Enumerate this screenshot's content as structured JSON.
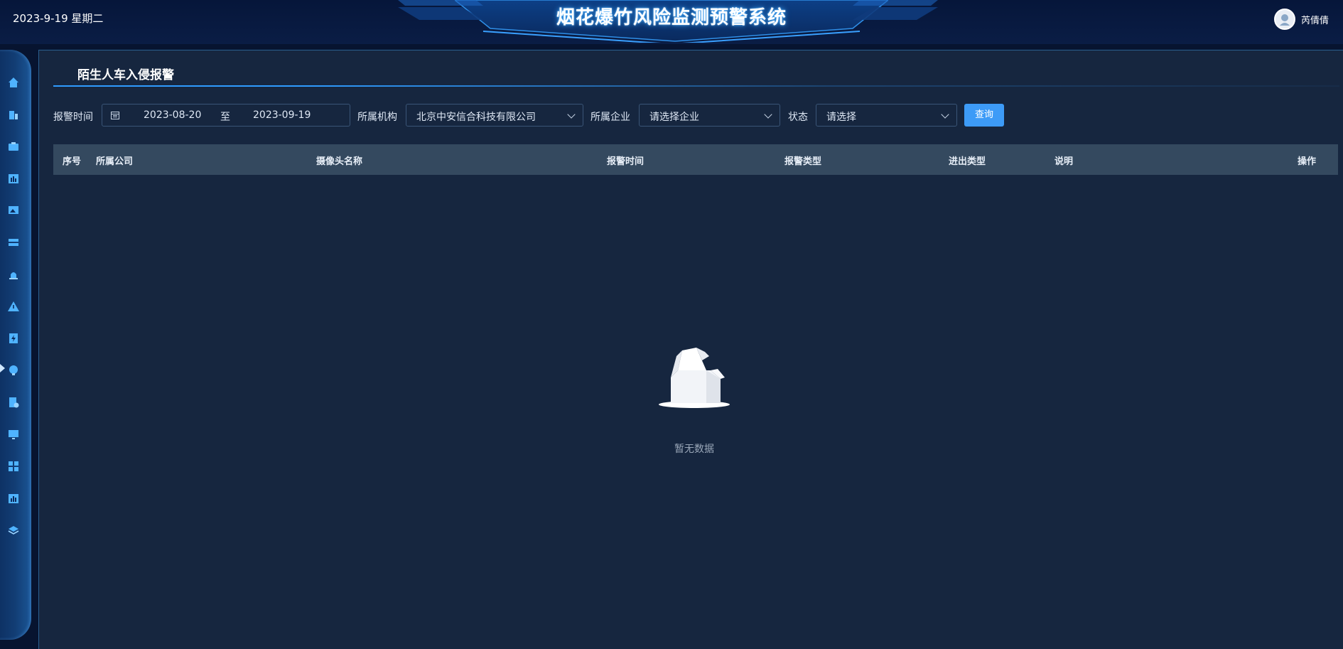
{
  "header": {
    "date": "2023-9-19 星期二",
    "title": "烟花爆竹风险监测预警系统",
    "user_name": "芮倩倩"
  },
  "sidebar": {
    "items": [
      {
        "icon": "home-icon"
      },
      {
        "icon": "building-icon"
      },
      {
        "icon": "briefcase-icon"
      },
      {
        "icon": "bar-chart-icon"
      },
      {
        "icon": "monitor-image-icon"
      },
      {
        "icon": "server-icon"
      },
      {
        "icon": "alarm-light-icon"
      },
      {
        "icon": "warning-triangle-icon"
      },
      {
        "icon": "power-document-icon"
      },
      {
        "icon": "bulb-icon"
      },
      {
        "icon": "document-settings-icon"
      },
      {
        "icon": "dashboard-screen-icon"
      },
      {
        "icon": "grid-icon"
      },
      {
        "icon": "report-chart-icon"
      },
      {
        "icon": "layers-icon"
      }
    ]
  },
  "panel": {
    "title": "陌生人车入侵报警"
  },
  "filters": {
    "alarm_time_label": "报警时间",
    "date_start": "2023-08-20",
    "date_sep": "至",
    "date_end": "2023-09-19",
    "org_label": "所属机构",
    "org_value": "北京中安信合科技有限公司",
    "company_label": "所属企业",
    "company_placeholder": "请选择企业",
    "status_label": "状态",
    "status_placeholder": "请选择",
    "query_label": "查询"
  },
  "table": {
    "columns": [
      "序号",
      "所属公司",
      "摄像头名称",
      "报警时间",
      "报警类型",
      "进出类型",
      "说明",
      "操作"
    ],
    "rows": [],
    "empty_text": "暂无数据"
  },
  "colors": {
    "background": "#16263f",
    "header_bg": "#071430",
    "table_head_bg": "#34495f",
    "accent": "#3d9bf7"
  }
}
